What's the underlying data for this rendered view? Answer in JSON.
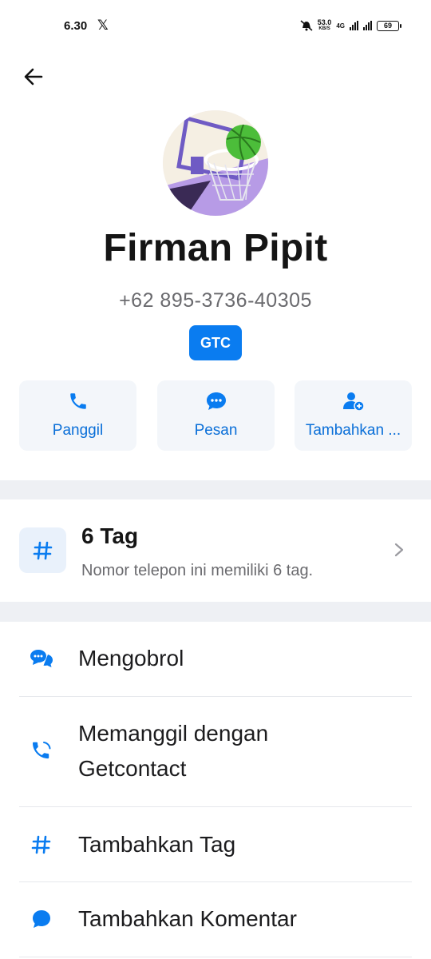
{
  "status_bar": {
    "time": "6.30",
    "x_logo": "𝕏",
    "speed_value": "53.0",
    "speed_unit": "KB/S",
    "network": "4G",
    "battery": "69"
  },
  "header": {
    "back_icon": "arrow-left-icon"
  },
  "profile": {
    "avatar_icon": "basketball-hoop-avatar",
    "name": "Firman Pipit",
    "phone": "+62 895-3736-40305",
    "badge": "GTC"
  },
  "actions": [
    {
      "label": "Panggil",
      "icon": "phone-icon"
    },
    {
      "label": "Pesan",
      "icon": "message-bubble-icon"
    },
    {
      "label": "Tambahkan ...",
      "icon": "add-user-icon"
    }
  ],
  "tag_section": {
    "title": "6 Tag",
    "subtitle": "Nomor telepon ini memiliki 6 tag.",
    "icon": "hashtag-icon"
  },
  "menu": [
    {
      "label": "Mengobrol",
      "icon": "chat-bubbles-icon"
    },
    {
      "label_line1": "Memanggil dengan",
      "label_line2": "Getcontact",
      "icon": "phone-call-icon"
    },
    {
      "label": "Tambahkan Tag",
      "icon": "hashtag-icon"
    },
    {
      "label": "Tambahkan Komentar",
      "icon": "comment-bubble-icon"
    }
  ],
  "colors": {
    "accent": "#0a7cf0",
    "accent_text": "#0a6fd8",
    "button_bg": "#f3f6fa",
    "divider": "#eef0f4"
  }
}
